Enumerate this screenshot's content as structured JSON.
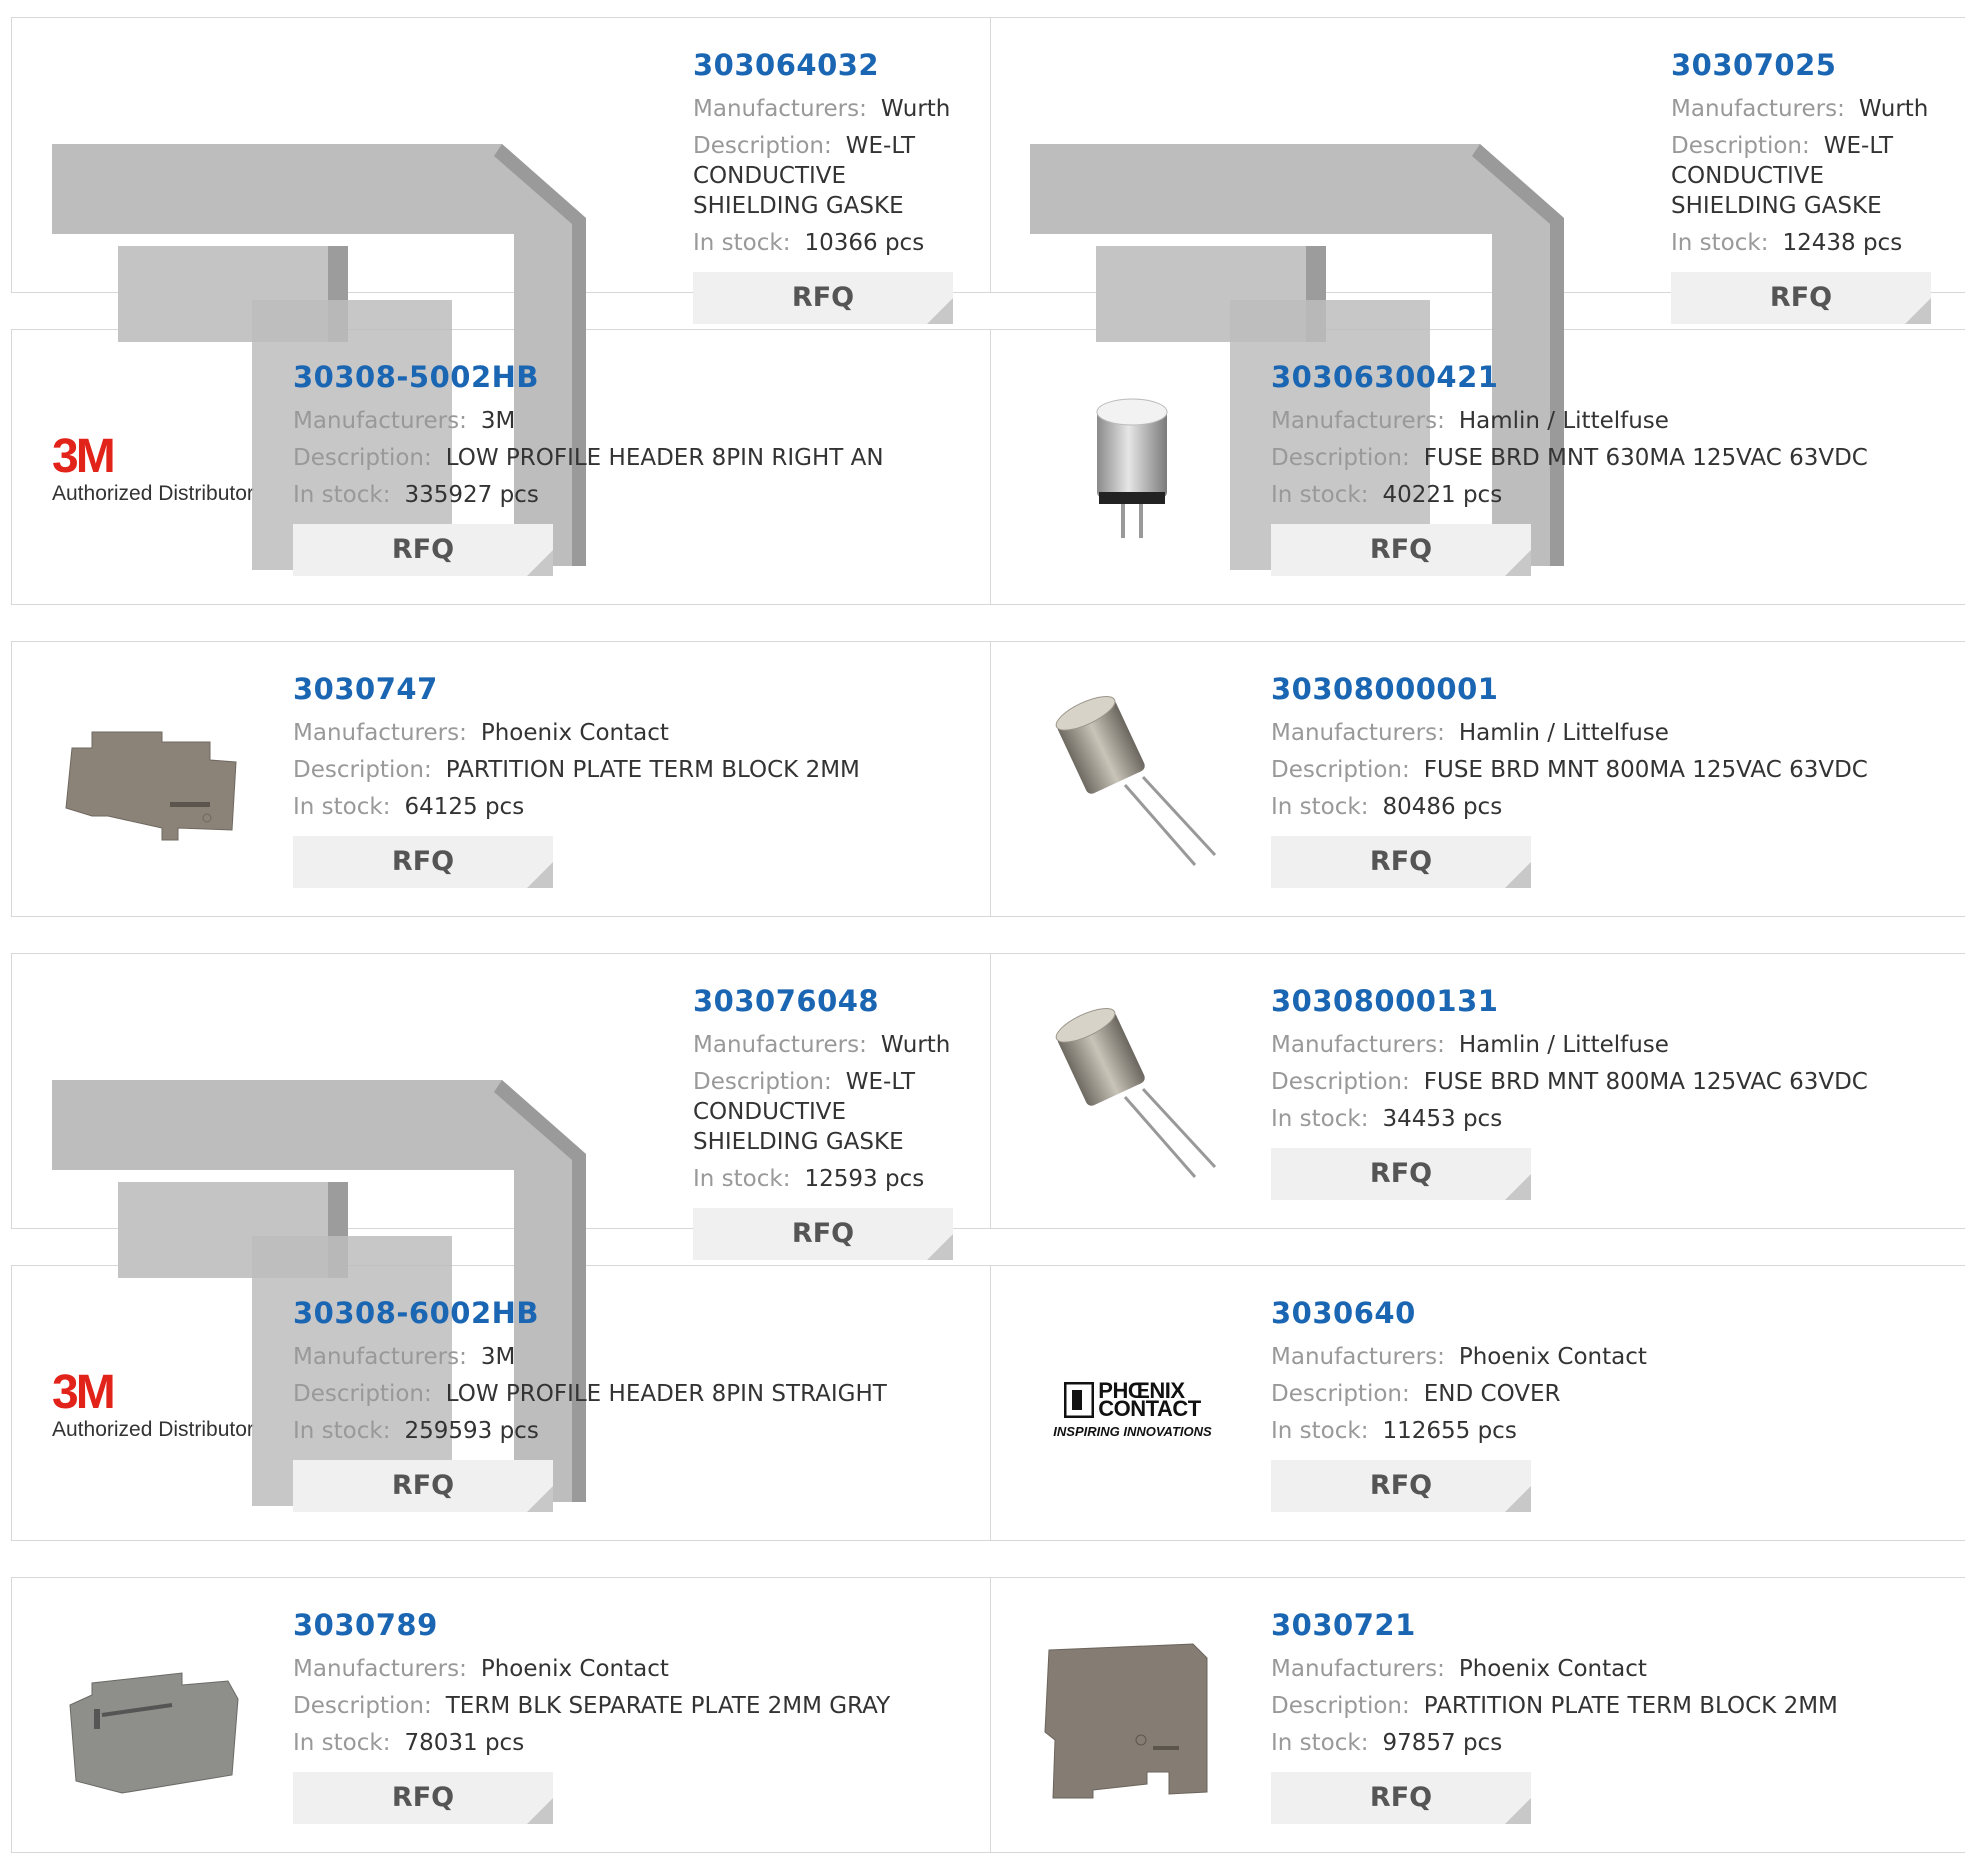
{
  "labels": {
    "manufacturers": "Manufacturers:",
    "description": "Description:",
    "in_stock": "In stock:",
    "rfq": "RFQ"
  },
  "products": [
    {
      "pn": "303064032",
      "mfr": "Wurth",
      "desc": "WE-LT CONDUCTIVE SHIELDING GASKE",
      "stock": "10366 pcs",
      "img": "gasket"
    },
    {
      "pn": "30307025",
      "mfr": "Wurth",
      "desc": "WE-LT CONDUCTIVE SHIELDING GASKE",
      "stock": "12438 pcs",
      "img": "gasket"
    },
    {
      "pn": "30308-5002HB",
      "mfr": "3M",
      "desc": "LOW PROFILE HEADER 8PIN RIGHT AN",
      "stock": "335927 pcs",
      "img": "3m-logo"
    },
    {
      "pn": "30306300421",
      "mfr": "Hamlin / Littelfuse",
      "desc": "FUSE BRD MNT 630MA 125VAC 63VDC",
      "stock": "40221 pcs",
      "img": "fuse-upright"
    },
    {
      "pn": "3030747",
      "mfr": "Phoenix Contact",
      "desc": "PARTITION PLATE TERM BLOCK 2MM",
      "stock": "64125 pcs",
      "img": "partition-plate"
    },
    {
      "pn": "30308000001",
      "mfr": "Hamlin / Littelfuse",
      "desc": "FUSE BRD MNT 800MA 125VAC 63VDC",
      "stock": "80486 pcs",
      "img": "fuse-angled"
    },
    {
      "pn": "303076048",
      "mfr": "Wurth",
      "desc": "WE-LT CONDUCTIVE SHIELDING GASKE",
      "stock": "12593 pcs",
      "img": "gasket"
    },
    {
      "pn": "30308000131",
      "mfr": "Hamlin / Littelfuse",
      "desc": "FUSE BRD MNT 800MA 125VAC 63VDC",
      "stock": "34453 pcs",
      "img": "fuse-angled"
    },
    {
      "pn": "30308-6002HB",
      "mfr": "3M",
      "desc": "LOW PROFILE HEADER 8PIN STRAIGHT",
      "stock": "259593 pcs",
      "img": "3m-logo"
    },
    {
      "pn": "3030640",
      "mfr": "Phoenix Contact",
      "desc": "END COVER",
      "stock": "112655 pcs",
      "img": "phoenix-logo"
    },
    {
      "pn": "3030789",
      "mfr": "Phoenix Contact",
      "desc": "TERM BLK SEPARATE PLATE 2MM GRAY",
      "stock": "78031 pcs",
      "img": "separate-plate"
    },
    {
      "pn": "3030721",
      "mfr": "Phoenix Contact",
      "desc": "PARTITION PLATE TERM BLOCK 2MM",
      "stock": "97857 pcs",
      "img": "partition-plate"
    }
  ],
  "logos": {
    "m3_mark": "3M",
    "m3_sub": "Authorized Distributor",
    "phoenix_line1": "PHŒNIX",
    "phoenix_line2": "CONTACT",
    "phoenix_tag": "INSPIRING INNOVATIONS"
  },
  "colors": {
    "link": "#1a66b3",
    "brand_3m": "#e2231a"
  }
}
